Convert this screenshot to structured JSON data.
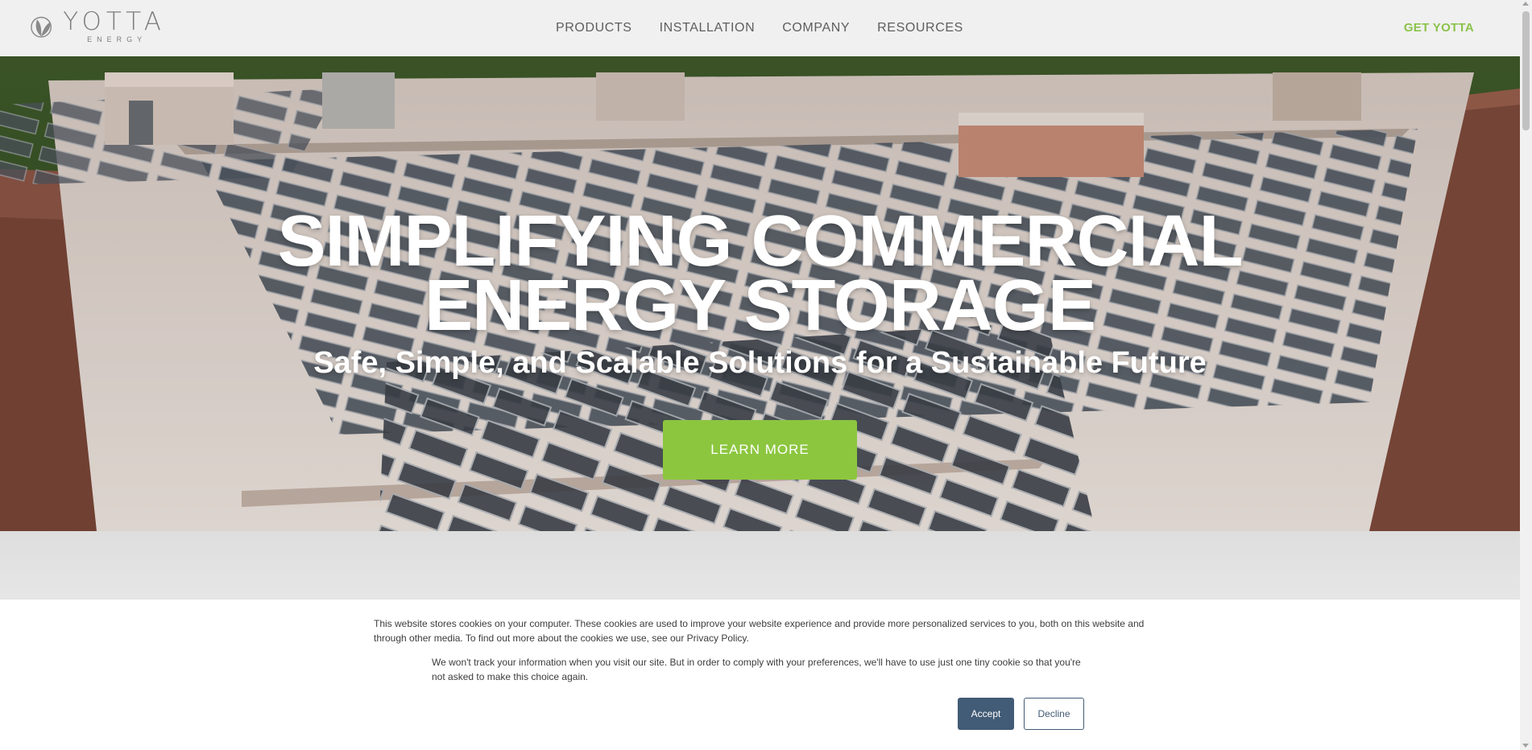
{
  "header": {
    "logo": {
      "word": "YOTTA",
      "sub": "ENERGY"
    },
    "nav": [
      "PRODUCTS",
      "INSTALLATION",
      "COMPANY",
      "RESOURCES"
    ],
    "cta_label": "GET YOTTA"
  },
  "hero": {
    "title_line1": "SIMPLIFYING COMMERCIAL",
    "title_line2": "ENERGY STORAGE",
    "subtitle": "Safe, Simple, and Scalable Solutions for a Sustainable Future",
    "button_label": "LEARN MORE"
  },
  "cookie_banner": {
    "text_main": "This website stores cookies on your computer. These cookies are used to improve your website experience and provide more personalized services to you, both on this website and through other media. To find out more about the cookies we use, see our Privacy Policy.",
    "text_secondary": "We won't track your information when you visit our site. But in order to comply with your preferences, we'll have to use just one tiny cookie so that you're not asked to make this choice again.",
    "accept_label": "Accept",
    "decline_label": "Decline"
  },
  "colors": {
    "accent_green": "#8cc63f",
    "cookie_blue": "#425b76",
    "header_bg": "#f0f0f0"
  }
}
